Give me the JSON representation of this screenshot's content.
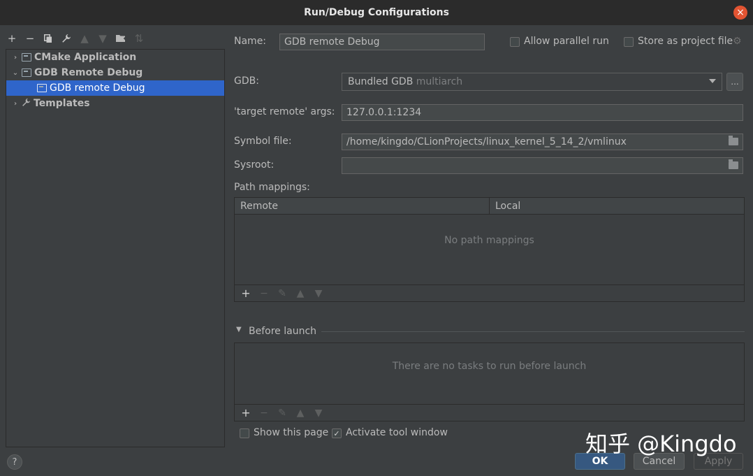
{
  "window": {
    "title": "Run/Debug Configurations",
    "close_icon": "close-icon"
  },
  "toolbar": {
    "items": [
      {
        "name": "add-icon",
        "glyph": "+",
        "enabled": true
      },
      {
        "name": "remove-icon",
        "glyph": "−",
        "enabled": true
      },
      {
        "name": "copy-icon",
        "glyph": "⧉",
        "enabled": true
      },
      {
        "name": "wrench-icon",
        "glyph": "🔧",
        "enabled": true
      },
      {
        "name": "move-up-icon",
        "glyph": "▲",
        "enabled": false
      },
      {
        "name": "move-down-icon",
        "glyph": "▼",
        "enabled": false
      },
      {
        "name": "new-folder-icon",
        "glyph": "▰",
        "enabled": true
      },
      {
        "name": "sort-icon",
        "glyph": "⇅",
        "enabled": false
      }
    ]
  },
  "tree": {
    "items": [
      {
        "label": "CMake Application",
        "level": 0,
        "expanded": false,
        "bold": true,
        "icon": "cmake-config-icon"
      },
      {
        "label": "GDB Remote Debug",
        "level": 0,
        "expanded": true,
        "bold": true,
        "icon": "gdb-config-icon"
      },
      {
        "label": "GDB remote Debug",
        "level": 1,
        "selected": true,
        "icon": "gdb-config-icon"
      },
      {
        "label": "Templates",
        "level": 0,
        "expanded": false,
        "bold": true,
        "icon": "wrench-icon"
      }
    ]
  },
  "form": {
    "name_label": "Name:",
    "name_value": "GDB remote Debug",
    "allow_parallel_label": "Allow parallel run",
    "allow_parallel_checked": false,
    "store_project_label": "Store as project file",
    "store_project_checked": false,
    "gdb_label": "GDB:",
    "gdb_value": "Bundled GDB",
    "gdb_value_hint": "multiarch",
    "gdb_more_label": "...",
    "target_label": "'target remote' args:",
    "target_value": "127.0.0.1:1234",
    "symbol_label": "Symbol file:",
    "symbol_value": "/home/kingdo/CLionProjects/linux_kernel_5_14_2/vmlinux",
    "sysroot_label": "Sysroot:",
    "sysroot_value": "",
    "path_mappings_label": "Path mappings:",
    "path_columns": [
      "Remote",
      "Local"
    ],
    "path_empty_text": "No path mappings",
    "before_launch_label": "Before launch",
    "before_launch_empty_text": "There are no tasks to run before launch",
    "show_page_label": "Show this page",
    "show_page_checked": false,
    "activate_tool_label": "Activate tool window",
    "activate_tool_checked": true
  },
  "footer": {
    "ok_label": "OK",
    "cancel_label": "Cancel",
    "apply_label": "Apply",
    "help_label": "?"
  },
  "watermark": "知乎 @Kingdo",
  "colors": {
    "background": "#3c3f41",
    "selection": "#2f65ca",
    "ok_button": "#365880",
    "close_button": "#e25432"
  }
}
